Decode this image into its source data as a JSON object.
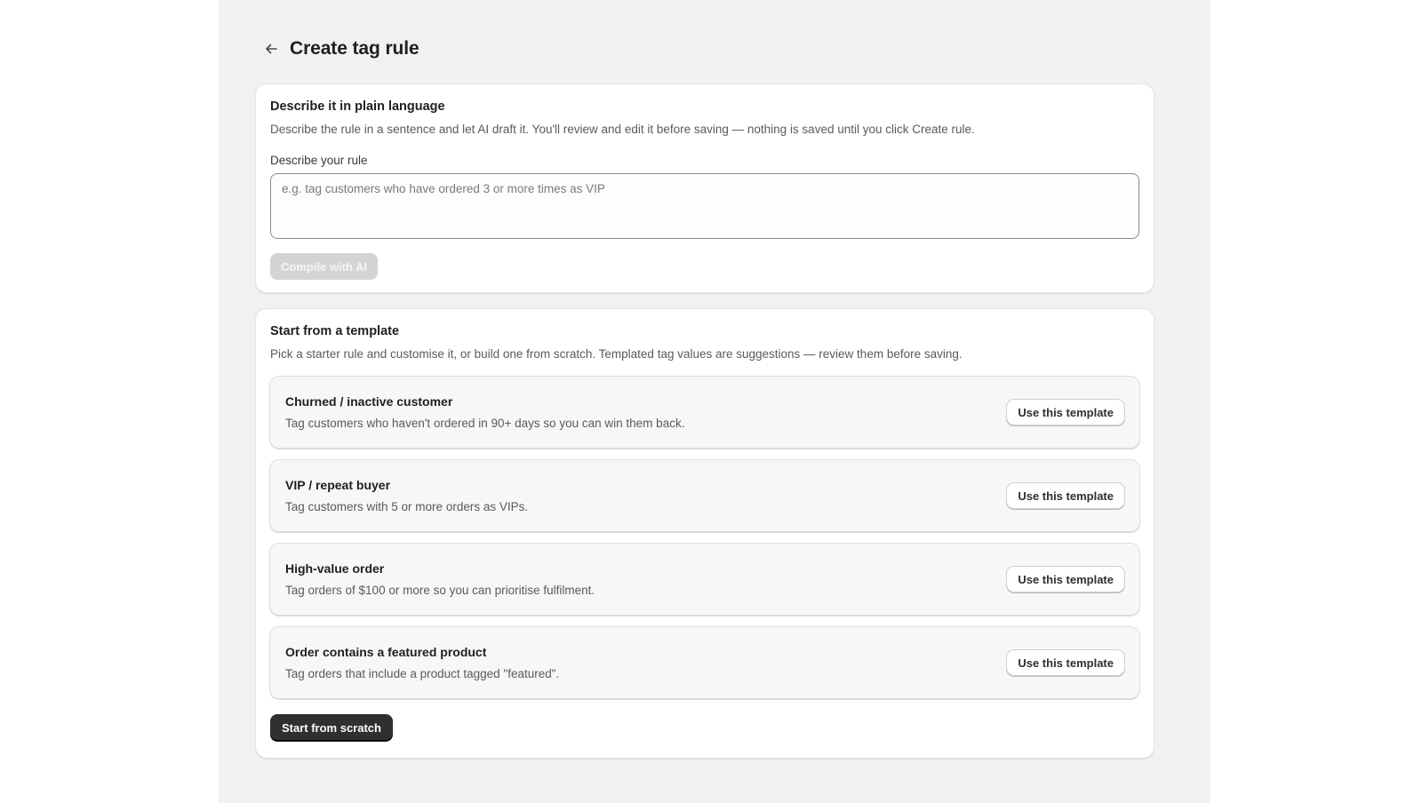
{
  "header": {
    "title": "Create tag rule",
    "back_icon": "arrow-left-icon"
  },
  "ai_card": {
    "heading": "Describe it in plain language",
    "description": "Describe the rule in a sentence and let AI draft it. You'll review and edit it before saving — nothing is saved until you click Create rule.",
    "field_label": "Describe your rule",
    "input_value": "",
    "input_placeholder": "e.g. tag customers who have ordered 3 or more times as VIP",
    "compile_label": "Compile with AI",
    "compile_disabled": true
  },
  "templates_card": {
    "heading": "Start from a template",
    "description": "Pick a starter rule and customise it, or build one from scratch. Templated tag values are suggestions — review them before saving.",
    "items": [
      {
        "title": "Churned / inactive customer",
        "description": "Tag customers who haven't ordered in 90+ days so you can win them back.",
        "button_label": "Use this template"
      },
      {
        "title": "VIP / repeat buyer",
        "description": "Tag customers with 5 or more orders as VIPs.",
        "button_label": "Use this template"
      },
      {
        "title": "High-value order",
        "description": "Tag orders of $100 or more so you can prioritise fulfilment.",
        "button_label": "Use this template"
      },
      {
        "title": "Order contains a featured product",
        "description": "Tag orders that include a product tagged \"featured\".",
        "button_label": "Use this template"
      }
    ],
    "scratch_label": "Start from scratch"
  },
  "colors": {
    "app_background": "#f1f1f1",
    "card_background": "#ffffff",
    "primary_button": "#303030",
    "disabled_button": "#d4d4d4"
  }
}
